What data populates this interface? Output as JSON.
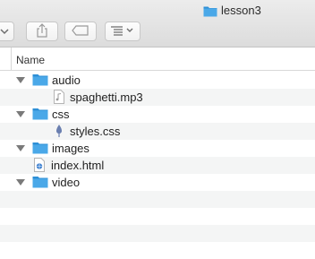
{
  "window": {
    "title": "lesson3",
    "title_icon": "folder-icon"
  },
  "toolbar": {
    "buttons": [
      {
        "icon": "chevron-down-icon"
      },
      {
        "icon": "share-icon"
      },
      {
        "icon": "tag-icon"
      },
      {
        "icon": "view-options-icon"
      }
    ]
  },
  "list": {
    "column_name": "Name",
    "rows": [
      {
        "label": "audio",
        "kind": "folder",
        "expanded": true,
        "level": 0
      },
      {
        "label": "spaghetti.mp3",
        "kind": "audio-file",
        "level": 1
      },
      {
        "label": "css",
        "kind": "folder",
        "expanded": true,
        "level": 0
      },
      {
        "label": "styles.css",
        "kind": "css-file",
        "level": 1
      },
      {
        "label": "images",
        "kind": "folder",
        "expanded": true,
        "level": 0
      },
      {
        "label": "index.html",
        "kind": "html-file",
        "level": 0
      },
      {
        "label": "video",
        "kind": "folder",
        "expanded": true,
        "level": 0
      }
    ]
  },
  "colors": {
    "folder": "#4aa8e8",
    "folder_dark": "#2d8fd6",
    "stripe": "#f4f5f5"
  }
}
